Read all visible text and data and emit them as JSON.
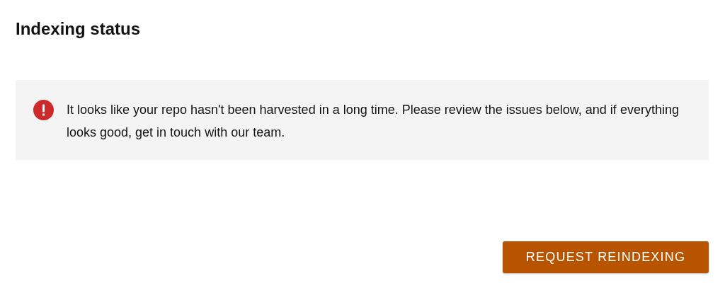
{
  "title": "Indexing status",
  "alert": {
    "kind": "error",
    "message": "It looks like your repo hasn't been harvested in a long time. Please review the issues below, and if everything looks good, get in touch with our team."
  },
  "button": {
    "label": "REQUEST REINDEXING"
  }
}
